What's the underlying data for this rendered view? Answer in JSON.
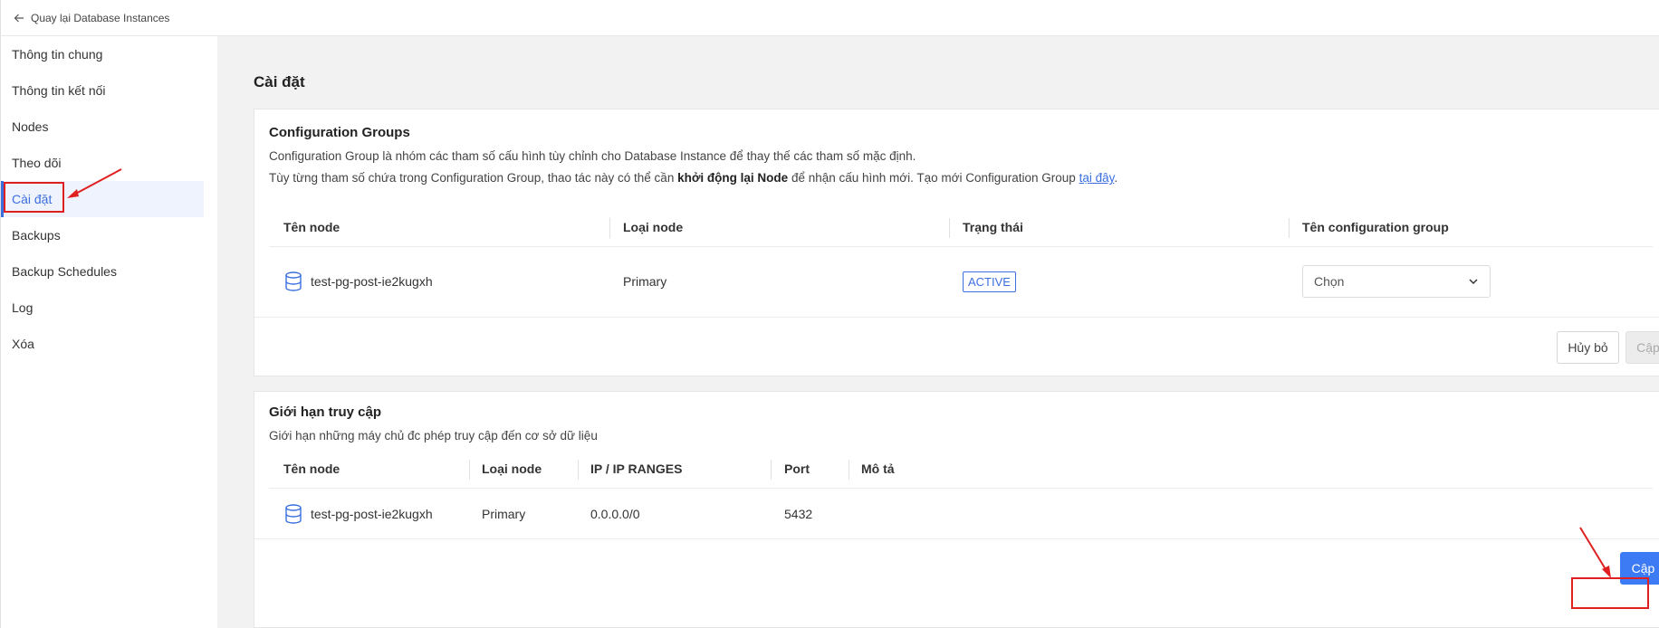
{
  "topbar": {
    "back_label": "Quay lại Database Instances"
  },
  "sidebar": {
    "items": [
      {
        "label": "Thông tin chung",
        "active": false
      },
      {
        "label": "Thông tin kết nối",
        "active": false
      },
      {
        "label": "Nodes",
        "active": false
      },
      {
        "label": "Theo dõi",
        "active": false
      },
      {
        "label": "Cài đặt",
        "active": true
      },
      {
        "label": "Backups",
        "active": false
      },
      {
        "label": "Backup Schedules",
        "active": false
      },
      {
        "label": "Log",
        "active": false
      },
      {
        "label": "Xóa",
        "active": false
      }
    ]
  },
  "page": {
    "title": "Cài đặt"
  },
  "config_groups": {
    "title": "Configuration Groups",
    "desc_line1": "Configuration Group là nhóm các tham số cấu hình tùy chỉnh cho Database Instance để thay thế các tham số mặc định.",
    "desc_line2_prefix": "Tùy từng tham số chứa trong Configuration Group, thao tác này có thể cần ",
    "desc_line2_bold": "khởi động lại Node",
    "desc_line2_middle": " để nhận cấu hình mới. Tạo mới Configuration Group ",
    "desc_line2_link": "tại đây",
    "desc_line2_suffix": ".",
    "columns": [
      "Tên node",
      "Loại node",
      "Trạng thái",
      "Tên configuration group"
    ],
    "rows": [
      {
        "node_name": "test-pg-post-ie2kugxh",
        "node_type": "Primary",
        "status": "ACTIVE",
        "select_placeholder": "Chọn"
      }
    ],
    "cancel_label": "Hủy bỏ",
    "update_label": "Cập nhật"
  },
  "access_limit": {
    "title": "Giới hạn truy cập",
    "desc": "Giới hạn những máy chủ đc phép truy cập đến cơ sở dữ liệu",
    "columns": [
      "Tên node",
      "Loại node",
      "IP / IP RANGES",
      "Port",
      "Mô tả"
    ],
    "rows": [
      {
        "node_name": "test-pg-post-ie2kugxh",
        "node_type": "Primary",
        "ip": "0.0.0.0/0",
        "port": "5432",
        "desc": ""
      }
    ],
    "update_label": "Cập nhật"
  },
  "colors": {
    "accent": "#3b6fe0",
    "primary_button": "#3d7bf5",
    "annotation_red": "#e02020"
  }
}
